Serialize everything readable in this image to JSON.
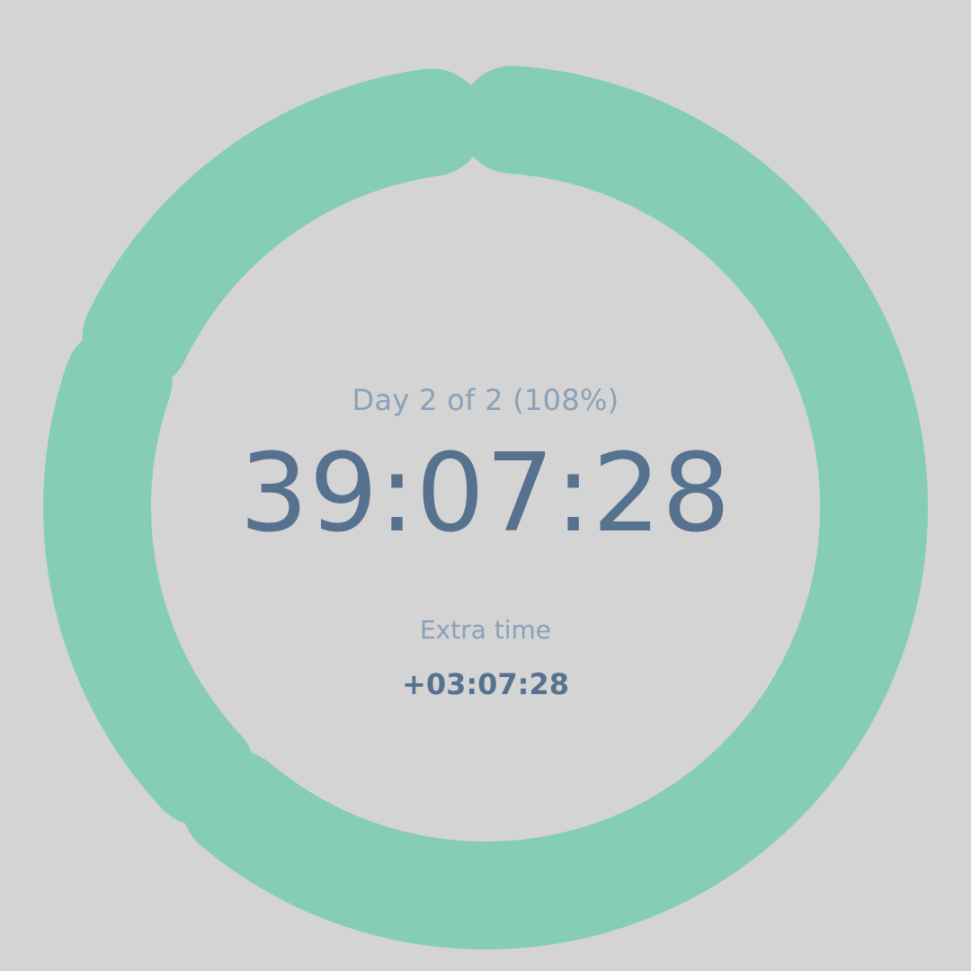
{
  "colors": {
    "background": "#d4d4d4",
    "ring": "#86cdb5",
    "primary_text": "#56728f",
    "secondary_text": "#8aa1b7"
  },
  "progress": {
    "day_label": "Day 2 of 2 (108%)",
    "percent": 108,
    "segments": 3
  },
  "timer": {
    "elapsed": "39:07:28"
  },
  "extra": {
    "label": "Extra time",
    "value": "+03:07:28"
  }
}
